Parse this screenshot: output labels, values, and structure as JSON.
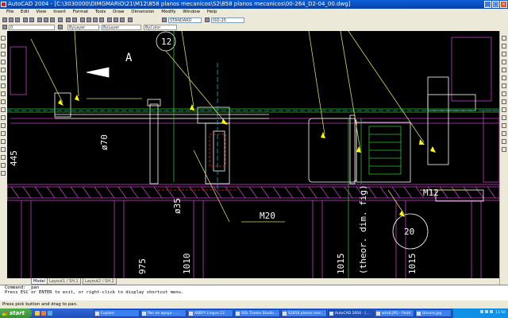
{
  "window": {
    "title": "AutoCAD 2004 - [C:\\3030000\\DIMGMARIO\\21\\M12\\858 planos mecanicos\\S2\\858 planos mecanicos\\00-264_D2-04_00.dwg]",
    "controls": [
      "_",
      "□",
      "×"
    ]
  },
  "menu": [
    "File",
    "Edit",
    "View",
    "Insert",
    "Format",
    "Tools",
    "Draw",
    "Dimension",
    "Modify",
    "Window",
    "Help"
  ],
  "toolbar": {
    "text_style": "STANDARD",
    "dim_style": "ISO-25",
    "layer": "0",
    "color": "ByLayer",
    "linetype": "ByLayer",
    "lineweight": "ByColor"
  },
  "drawing": {
    "labels": {
      "balloon_12": "12",
      "view_a": "A",
      "dia_70": "ø70",
      "dim_445": "445",
      "dia_35": "ø35",
      "m20": "M20",
      "m12": "M12",
      "balloon_20": "20",
      "dim_975": "975",
      "dim_1010": "1010",
      "dim_1015a": "1015",
      "dim_1015b": "1015",
      "theor": "(theor. dim. fig)"
    },
    "colors": {
      "background": "#000000",
      "magenta": "#c040c0",
      "white": "#ffffff",
      "green": "#30c030",
      "yellow": "#ffff00",
      "cyan": "#00c0c0",
      "red": "#ff2020"
    }
  },
  "tabs": [
    "Model",
    "Layout1 / SH.1",
    "Layout2 / SH.2"
  ],
  "command": {
    "line1": "Command: _pan",
    "line2": "Press ESC or ENTER to exit, or right-click to display shortcut menu."
  },
  "status": "Press pick button and drag to pan.",
  "taskbar": {
    "start": "start",
    "tasks": [
      "Explore",
      "Pan de apoyo - ...",
      "ABBYY Lingvo 12",
      "SOL Tradex Studio ...",
      "S2858 planos mec...",
      "AutoCAD 2004 - [...",
      "whsb.JPG - Paint",
      "Unsure.jpg"
    ],
    "clock": "11:50"
  }
}
